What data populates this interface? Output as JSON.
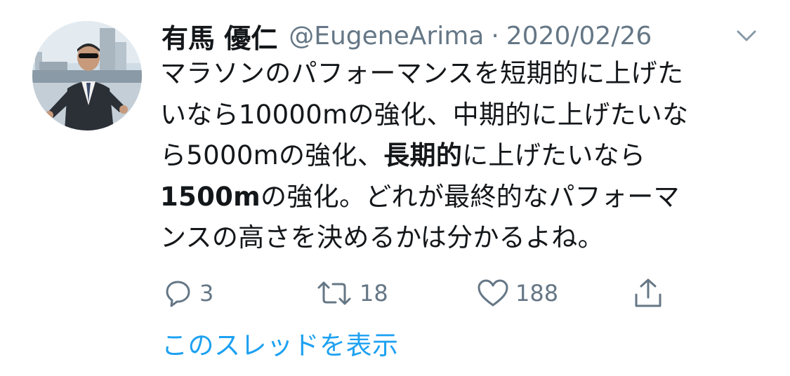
{
  "tweet": {
    "author": {
      "display_name": "有馬 優仁",
      "handle": "@EugeneArima",
      "avatar_icon": "profile-photo"
    },
    "separator": "·",
    "date": "2020/02/26",
    "menu_icon": "chevron-down-icon",
    "text_lines": [
      {
        "segments": [
          {
            "text": "マラソンのパフォーマンスを短期的に上げた",
            "bold": false
          }
        ]
      },
      {
        "segments": [
          {
            "text": "いなら10000mの強化、中期的に上げたいな",
            "bold": false
          }
        ]
      },
      {
        "segments": [
          {
            "text": "ら5000mの強化、",
            "bold": false
          },
          {
            "text": "長期的",
            "bold": true
          },
          {
            "text": "に上げたいなら",
            "bold": false
          }
        ]
      },
      {
        "segments": [
          {
            "text": "1500m",
            "bold": true
          },
          {
            "text": "の強化。どれが最終的なパフォーマ",
            "bold": false
          }
        ]
      },
      {
        "segments": [
          {
            "text": "ンスの高さを決めるかは分かるよね。",
            "bold": false
          }
        ]
      }
    ],
    "actions": {
      "reply": {
        "icon": "reply-icon",
        "count": "3"
      },
      "retweet": {
        "icon": "retweet-icon",
        "count": "18"
      },
      "like": {
        "icon": "heart-icon",
        "count": "188"
      },
      "share": {
        "icon": "share-icon"
      }
    },
    "thread_link": "このスレッドを表示"
  },
  "colors": {
    "text_primary": "#14171a",
    "text_secondary": "#657786",
    "link": "#1da1f2"
  }
}
